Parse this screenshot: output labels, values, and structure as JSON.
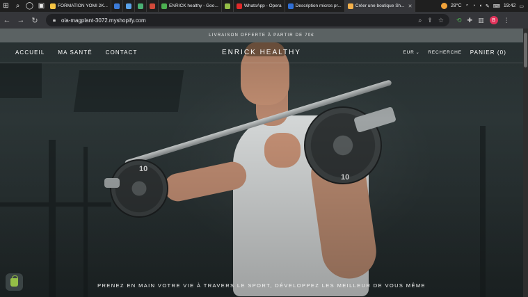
{
  "taskbar": {
    "tabs": [
      {
        "label": "FORMATION YOMI 2K...",
        "color": "#f6c443",
        "active": false
      },
      {
        "label": "",
        "color": "#3c7bd8",
        "active": false
      },
      {
        "label": "",
        "color": "#5aa2e8",
        "active": false
      },
      {
        "label": "",
        "color": "#4ab074",
        "active": false
      },
      {
        "label": "",
        "color": "#d14a3a",
        "active": false
      },
      {
        "label": "ENRICK healthy - Goo...",
        "color": "#4caf50",
        "active": false
      },
      {
        "label": "",
        "color": "#95bf47",
        "active": false
      },
      {
        "label": "WhatsApp - Opera",
        "color": "#e02a2a",
        "active": false
      },
      {
        "label": "Description micros pr...",
        "color": "#2f6fd6",
        "active": false
      },
      {
        "label": "Créer une boutique Sh...",
        "color": "#f5b14a",
        "active": true
      }
    ],
    "weather": "28°C",
    "clock": "19:42"
  },
  "browser": {
    "url": "ola-magplant-3072.myshopify.com",
    "avatar_initial": "B"
  },
  "shop": {
    "announcement": "LIVRAISON OFFERTE À PARTIR DE 70€",
    "nav_left": [
      "ACCUEIL",
      "MA SANTÉ",
      "CONTACT"
    ],
    "brand": "ENRICK HEALTHY",
    "currency": "EUR",
    "search": "RECHERCHE",
    "cart": "PANIER (0)",
    "hero_tagline": "PRENEZ EN MAIN VOTRE VIE À TRAVERS LE SPORT, DÉVELOPPEZ LES MEILLEUR DE VOUS MÊME",
    "plate_left": "10",
    "plate_right": "10",
    "slides": 3,
    "active_slide": 2
  },
  "colors": {
    "announcement_bg": "#5b6263",
    "shopify_green": "#95bf47",
    "avatar": "#e2335b"
  }
}
